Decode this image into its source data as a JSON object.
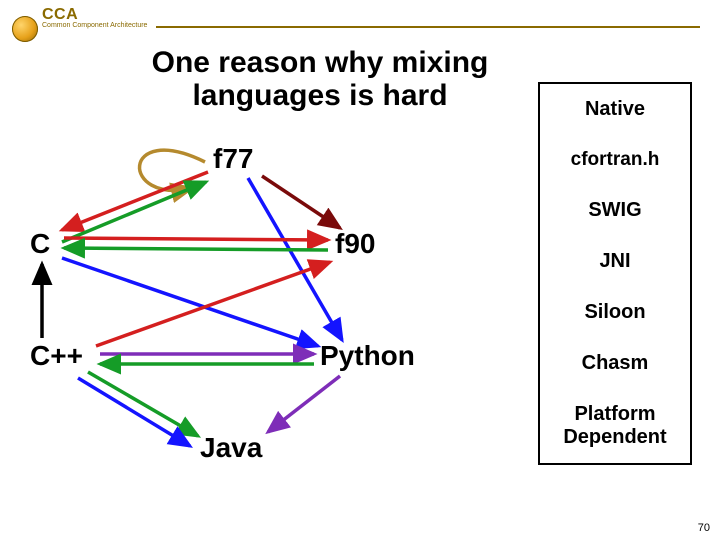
{
  "header": {
    "abbr": "CCA",
    "subtitle": "Common Component Architecture"
  },
  "title_line1": "One reason why mixing",
  "title_line2": "languages is hard",
  "nodes": {
    "f77": "f77",
    "c": "C",
    "f90": "f90",
    "cpp": "C++",
    "python": "Python",
    "java": "Java"
  },
  "sidebar": {
    "native": "Native",
    "cfortran": "cfortran.h",
    "swig": "SWIG",
    "jni": "JNI",
    "siloon": "Siloon",
    "chasm": "Chasm",
    "platform1": "Platform",
    "platform2": "Dependent"
  },
  "page_number": "70"
}
